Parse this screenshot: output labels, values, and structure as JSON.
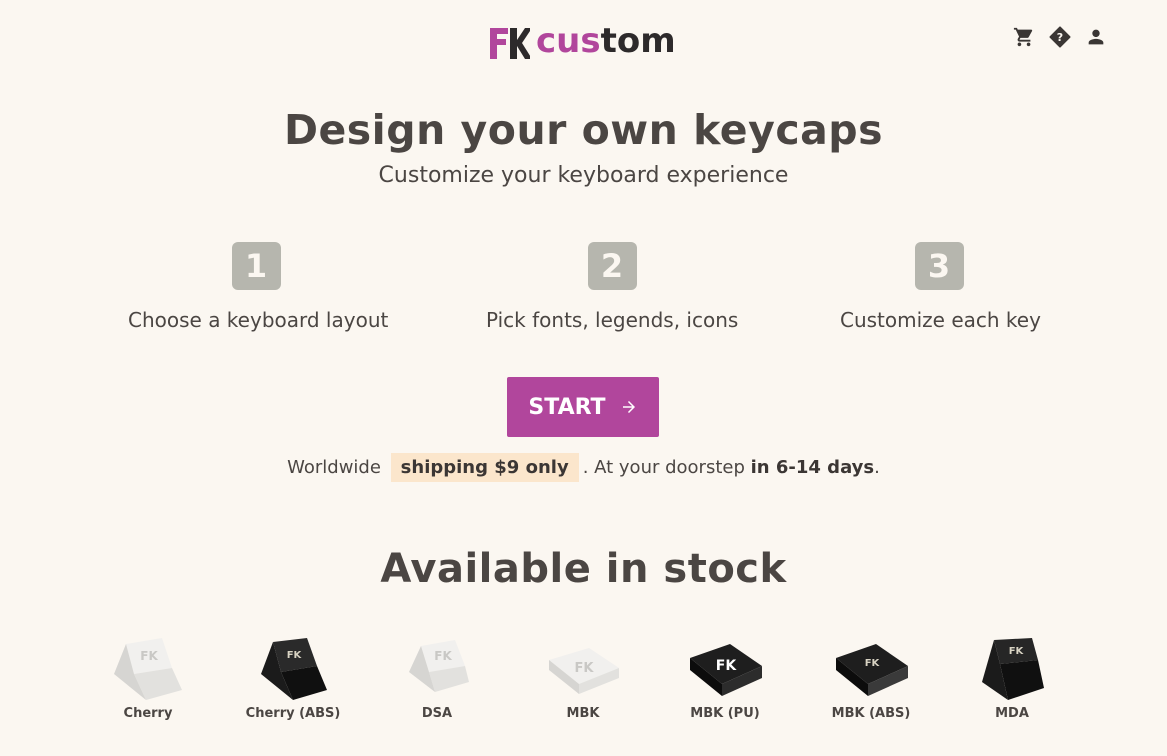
{
  "header": {
    "logo_text_part1": "cus",
    "logo_text_part2": "tom",
    "icons": [
      "cart-icon",
      "help-icon",
      "account-icon"
    ]
  },
  "hero": {
    "title": "Design your own keycaps",
    "subtitle": "Customize your keyboard experience"
  },
  "steps": [
    {
      "number": "1",
      "label": "Choose a keyboard layout"
    },
    {
      "number": "2",
      "label": "Pick fonts, legends, icons"
    },
    {
      "number": "3",
      "label": "Customize each key"
    }
  ],
  "start_button": {
    "label": "START",
    "icon": "arrow-right-icon"
  },
  "shipping": {
    "prefix": "Worldwide",
    "highlight": "shipping $9 only",
    "middle": ". At your doorstep",
    "days": "in 6-14 days",
    "suffix": "."
  },
  "stock": {
    "title": "Available in stock",
    "products": [
      {
        "name": "Cherry",
        "color": "white"
      },
      {
        "name": "Cherry (ABS)",
        "color": "black"
      },
      {
        "name": "DSA",
        "color": "white"
      },
      {
        "name": "MBK",
        "color": "white"
      },
      {
        "name": "MBK (PU)",
        "color": "black"
      },
      {
        "name": "MBK (ABS)",
        "color": "black"
      },
      {
        "name": "MDA",
        "color": "black"
      }
    ]
  },
  "colors": {
    "background": "#fbf7f1",
    "accent": "#b1469c",
    "step_badge": "#b6b6ae",
    "highlight": "#fbe6cc",
    "text": "#4b4643"
  }
}
